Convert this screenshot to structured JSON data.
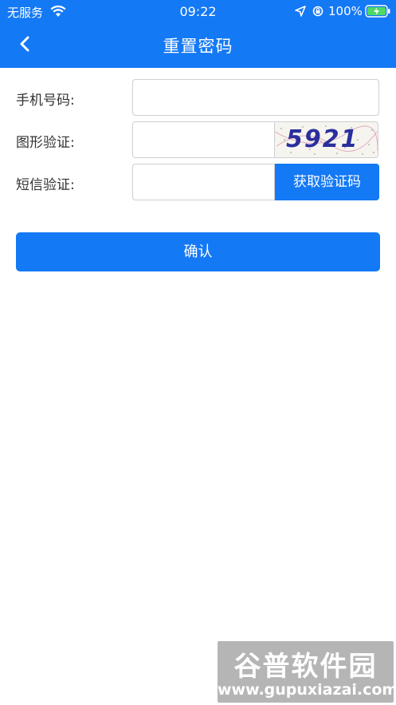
{
  "status_bar": {
    "carrier": "无服务",
    "time": "09:22",
    "battery": "100%"
  },
  "nav": {
    "title": "重置密码",
    "back_icon": "chevron-left-icon"
  },
  "form": {
    "phone_label": "手机号码:",
    "phone_value": "",
    "captcha_label": "图形验证:",
    "captcha_value": "",
    "captcha_text": "5921",
    "sms_label": "短信验证:",
    "sms_value": "",
    "sms_button": "获取验证码"
  },
  "confirm_button": "确认",
  "watermark": {
    "logo": "谷普软件园",
    "url": "www.gupuxiazai.com"
  },
  "colors": {
    "primary": "#1479f5",
    "background": "#ffffff",
    "text": "#333333"
  }
}
